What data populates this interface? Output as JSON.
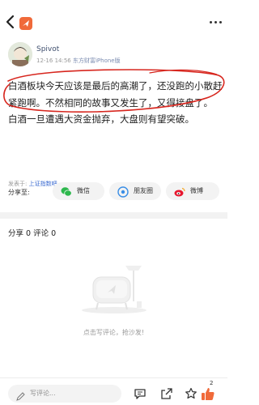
{
  "header": {
    "back_icon": "chevron-left-icon",
    "logo_icon": "app-logo-icon",
    "more_icon": "ellipsis-icon"
  },
  "author": {
    "username": "Spivot",
    "timestamp": "12-16 14:56",
    "device": "东方财富iPhone版"
  },
  "post": {
    "paragraphs": [
      "白酒板块今天应该是最后的高潮了，还没跑的小散赶紧跑啊。不然相同的故事又发生了，又得接盘了。",
      "白酒一旦遭遇大资金抛弃，大盘则有望突破。"
    ],
    "annotation_color": "#d7261e"
  },
  "published_in": {
    "prefix": "发表于:",
    "forum": "上证指数吧"
  },
  "share": {
    "label": "分享至:",
    "targets": [
      {
        "label": "微信",
        "icon": "wechat-icon",
        "color": "#2db84d"
      },
      {
        "label": "朋友圈",
        "icon": "moments-icon",
        "color": "#3a8ee6"
      },
      {
        "label": "微博",
        "icon": "weibo-icon",
        "color": "#e6162d"
      }
    ]
  },
  "stats": {
    "text": "分享 0  评论 0"
  },
  "empty_state": {
    "text": "点击写评论，抢沙发!"
  },
  "bottom_bar": {
    "comment_placeholder": "写评论...",
    "like_count": "2",
    "icons": [
      "comment-icon",
      "share-out-icon",
      "favorite-icon",
      "thumbs-up-icon"
    ]
  },
  "colors": {
    "accent": "#f06a3a",
    "link": "#3b6bd1",
    "username": "#3f4f6e"
  }
}
